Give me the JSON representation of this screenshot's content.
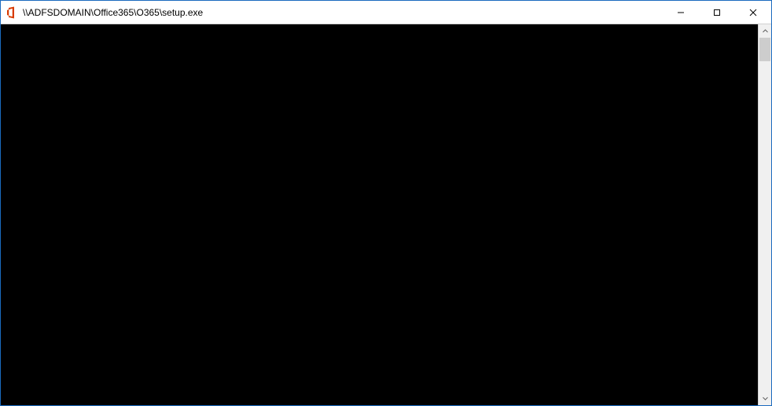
{
  "window": {
    "title": "\\\\ADFSDOMAIN\\Office365\\O365\\setup.exe",
    "icon_name": "office-icon"
  },
  "controls": {
    "minimize_glyph": "—",
    "maximize_glyph": "☐",
    "close_glyph": "✕"
  },
  "scrollbar": {
    "up_glyph": "▲",
    "down_glyph": "▼"
  }
}
